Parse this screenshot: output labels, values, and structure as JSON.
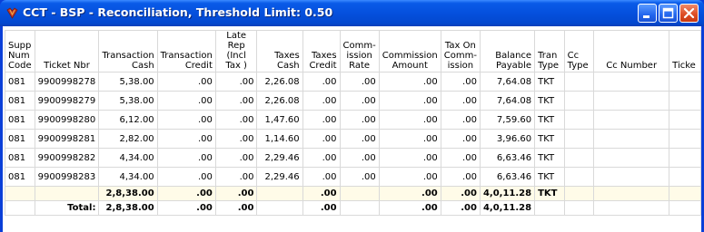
{
  "window": {
    "title": "CCT - BSP - Reconciliation, Threshold Limit: 0.50",
    "icon": "app-icon",
    "controls": [
      "minimize-icon",
      "maximize-icon",
      "close-icon"
    ]
  },
  "table": {
    "headers": [
      {
        "label": "Supp Num Code",
        "align": "l"
      },
      {
        "label": "Ticket Nbr",
        "align": "c"
      },
      {
        "label": "Transaction Cash",
        "align": "r"
      },
      {
        "label": "Transaction Credit",
        "align": "r"
      },
      {
        "label": "Late Rep (Incl Tax )",
        "align": "c"
      },
      {
        "label": "Taxes Cash",
        "align": "r"
      },
      {
        "label": "Taxes Credit",
        "align": "r"
      },
      {
        "label": "Comm- ission Rate",
        "align": "c"
      },
      {
        "label": "Commission Amount",
        "align": "c"
      },
      {
        "label": "Tax On Comm- ission",
        "align": "c"
      },
      {
        "label": "Balance Payable",
        "align": "r"
      },
      {
        "label": "Tran Type",
        "align": "l"
      },
      {
        "label": "Cc Type",
        "align": "l"
      },
      {
        "label": "Cc Number",
        "align": "c"
      },
      {
        "label": "Ticke",
        "align": "l"
      }
    ],
    "rows": [
      [
        "081",
        "9900998278",
        "5,38.00",
        ".00",
        ".00",
        "2,26.08",
        ".00",
        ".00",
        ".00",
        ".00",
        "7,64.08",
        "TKT",
        "",
        "",
        ""
      ],
      [
        "081",
        "9900998279",
        "5,38.00",
        ".00",
        ".00",
        "2,26.08",
        ".00",
        ".00",
        ".00",
        ".00",
        "7,64.08",
        "TKT",
        "",
        "",
        ""
      ],
      [
        "081",
        "9900998280",
        "6,12.00",
        ".00",
        ".00",
        "1,47.60",
        ".00",
        ".00",
        ".00",
        ".00",
        "7,59.60",
        "TKT",
        "",
        "",
        ""
      ],
      [
        "081",
        "9900998281",
        "2,82.00",
        ".00",
        ".00",
        "1,14.60",
        ".00",
        ".00",
        ".00",
        ".00",
        "3,96.60",
        "TKT",
        "",
        "",
        ""
      ],
      [
        "081",
        "9900998282",
        "4,34.00",
        ".00",
        ".00",
        "2,29.46",
        ".00",
        ".00",
        ".00",
        ".00",
        "6,63.46",
        "TKT",
        "",
        "",
        ""
      ],
      [
        "081",
        "9900998283",
        "4,34.00",
        ".00",
        ".00",
        "2,29.46",
        ".00",
        ".00",
        ".00",
        ".00",
        "6,63.46",
        "TKT",
        "",
        "",
        ""
      ]
    ],
    "subtotal": [
      "",
      "",
      "2,8,38.00",
      ".00",
      ".00",
      "",
      ".00",
      "",
      ".00",
      ".00",
      "4,0,11.28",
      "TKT",
      "",
      "",
      ""
    ],
    "total": [
      "",
      "Total:",
      "2,8,38.00",
      ".00",
      ".00",
      "",
      ".00",
      "",
      ".00",
      ".00",
      "4,0,11.28",
      "",
      "",
      "",
      ""
    ]
  },
  "colors": {
    "titlebar": "#0550dd",
    "subtotal_bg": "#fffbe8",
    "grid": "#d9d9d9",
    "close_button": "#dc4a22"
  }
}
